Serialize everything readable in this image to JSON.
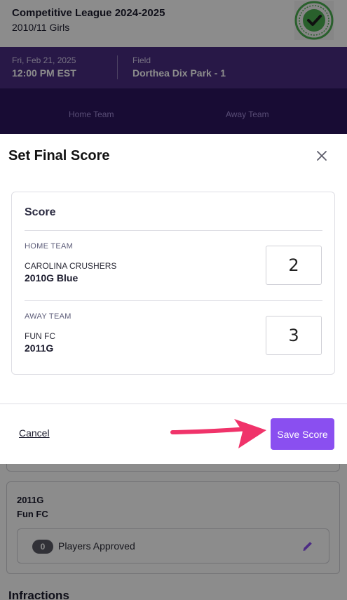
{
  "header": {
    "league_title": "Competitive League 2024-2025",
    "division": "2010/11 Girls",
    "badge_icon": "approved-check-badge-icon"
  },
  "game_info": {
    "date": "Fri, Feb 21, 2025",
    "time": "12:00 PM EST",
    "field_label": "Field",
    "field_value": "Dorthea Dix Park - 1"
  },
  "tabs": {
    "home": "Home Team",
    "away": "Away Team"
  },
  "background_team_card": {
    "team_code": "2011G",
    "team_name": "Fun FC",
    "players_count": "0",
    "players_label": "Players Approved"
  },
  "infractions_heading": "Infractions",
  "modal": {
    "title": "Set Final Score",
    "score_heading": "Score",
    "home": {
      "side_label": "HOME TEAM",
      "club": "CAROLINA CRUSHERS",
      "team": "2010G Blue",
      "score": "2"
    },
    "away": {
      "side_label": "AWAY TEAM",
      "club": "FUN FC",
      "team": "2011G",
      "score": "3"
    },
    "cancel_label": "Cancel",
    "save_label": "Save Score"
  },
  "colors": {
    "accent": "#8a4ff0",
    "header_purple": "#4a2d82",
    "tabs_purple": "#2d1660",
    "arrow": "#f0336a"
  }
}
